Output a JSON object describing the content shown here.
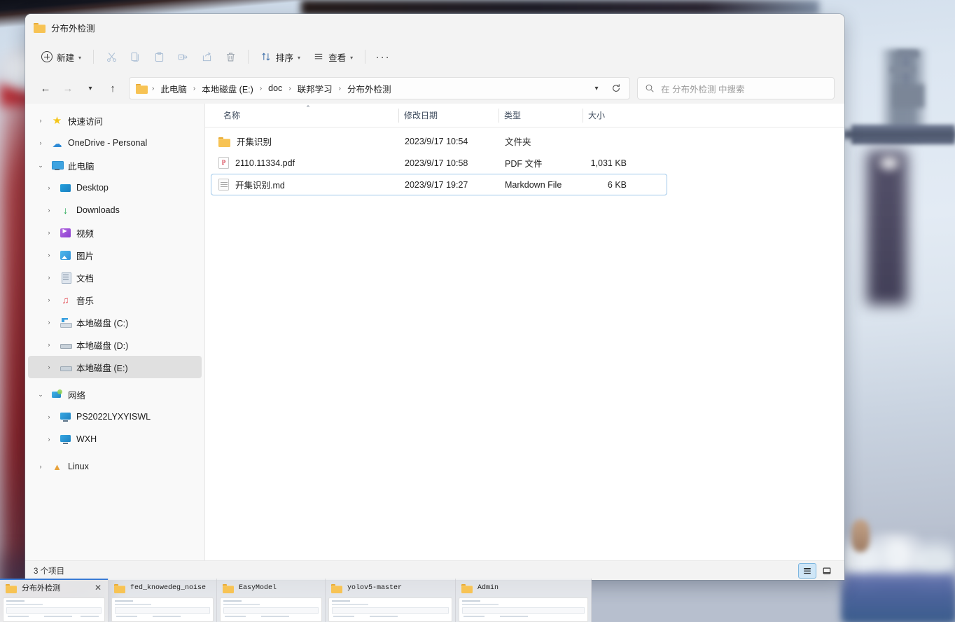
{
  "window": {
    "tab_title": "分布外检测",
    "folder_icon": "folder-icon"
  },
  "toolbar": {
    "new_label": "新建",
    "new_icon": "plus-circle-icon",
    "cut_icon": "scissors-icon",
    "copy_icon": "copy-icon",
    "paste_icon": "paste-icon",
    "rename_icon": "rename-icon",
    "share_icon": "share-icon",
    "delete_icon": "trash-icon",
    "sort_label": "排序",
    "sort_icon": "sort-arrows-icon",
    "view_label": "查看",
    "view_icon": "list-lines-icon",
    "more_label": "···",
    "more_icon": "ellipsis-icon"
  },
  "nav": {
    "back_icon": "arrow-left-icon",
    "forward_icon": "arrow-right-icon",
    "recent_icon": "chevron-down-icon",
    "up_icon": "arrow-up-icon",
    "breadcrumbs": [
      "此电脑",
      "本地磁盘 (E:)",
      "doc",
      "联邦学习",
      "分布外检测"
    ],
    "separator": "›",
    "dropdown_icon": "chevron-down-icon",
    "refresh_icon": "refresh-icon",
    "search_placeholder": "在 分布外检测 中搜索",
    "search_icon": "search-icon",
    "search_value": ""
  },
  "sidebar": {
    "items": [
      {
        "label": "快速访问",
        "level": 0,
        "icon": "star-icon",
        "expander": "›",
        "selected": false
      },
      {
        "label": "OneDrive - Personal",
        "level": 0,
        "icon": "cloud-icon",
        "expander": "›",
        "selected": false
      },
      {
        "label": "此电脑",
        "level": 0,
        "icon": "this-pc-icon",
        "expander": "⌄",
        "selected": false
      },
      {
        "label": "Desktop",
        "level": 1,
        "icon": "desktop-icon",
        "expander": "›",
        "selected": false
      },
      {
        "label": "Downloads",
        "level": 1,
        "icon": "downloads-icon",
        "expander": "›",
        "selected": false
      },
      {
        "label": "视频",
        "level": 1,
        "icon": "videos-icon",
        "expander": "›",
        "selected": false
      },
      {
        "label": "图片",
        "level": 1,
        "icon": "pictures-icon",
        "expander": "›",
        "selected": false
      },
      {
        "label": "文档",
        "level": 1,
        "icon": "documents-icon",
        "expander": "›",
        "selected": false
      },
      {
        "label": "音乐",
        "level": 1,
        "icon": "music-icon",
        "expander": "›",
        "selected": false
      },
      {
        "label": "本地磁盘 (C:)",
        "level": 1,
        "icon": "system-drive-icon",
        "expander": "›",
        "selected": false
      },
      {
        "label": "本地磁盘 (D:)",
        "level": 1,
        "icon": "drive-icon",
        "expander": "›",
        "selected": false
      },
      {
        "label": "本地磁盘 (E:)",
        "level": 1,
        "icon": "drive-icon",
        "expander": "›",
        "selected": true
      },
      {
        "label": "网络",
        "level": 0,
        "icon": "network-icon",
        "expander": "⌄",
        "selected": false
      },
      {
        "label": "PS2022LYXYISWL",
        "level": 1,
        "icon": "computer-icon",
        "expander": "›",
        "selected": false
      },
      {
        "label": "WXH",
        "level": 1,
        "icon": "computer-icon",
        "expander": "›",
        "selected": false
      },
      {
        "label": "Linux",
        "level": 0,
        "icon": "linux-icon",
        "expander": "›",
        "selected": false
      }
    ]
  },
  "filelist": {
    "columns": [
      {
        "key": "name",
        "label": "名称",
        "sorted": true,
        "sort_caret": "⌃"
      },
      {
        "key": "date",
        "label": "修改日期",
        "sorted": false,
        "sort_caret": ""
      },
      {
        "key": "type",
        "label": "类型",
        "sorted": false,
        "sort_caret": ""
      },
      {
        "key": "size",
        "label": "大小",
        "sorted": false,
        "sort_caret": ""
      }
    ],
    "rows": [
      {
        "name": "开集识别",
        "date": "2023/9/17 10:54",
        "type": "文件夹",
        "size": "",
        "icon": "folder-icon",
        "selected": false
      },
      {
        "name": "2110.11334.pdf",
        "date": "2023/9/17 10:58",
        "type": "PDF 文件",
        "size": "1,031 KB",
        "icon": "pdf-file-icon",
        "selected": false
      },
      {
        "name": "开集识别.md",
        "date": "2023/9/17 19:27",
        "type": "Markdown File",
        "size": "6 KB",
        "icon": "md-file-icon",
        "selected": true
      }
    ]
  },
  "statusbar": {
    "item_count": "3 个项目",
    "view_details_icon": "details-view-icon",
    "view_tiles_icon": "tiles-view-icon",
    "active_view": "details"
  },
  "taskbar": {
    "items": [
      {
        "label": "分布外检测",
        "active": true,
        "mono": false,
        "close_icon": "close-icon"
      },
      {
        "label": "fed_knowedeg_noise",
        "active": false,
        "mono": true,
        "close_icon": ""
      },
      {
        "label": "EasyModel",
        "active": false,
        "mono": true,
        "close_icon": ""
      },
      {
        "label": "yolov5-master",
        "active": false,
        "mono": true,
        "close_icon": ""
      },
      {
        "label": "Admin",
        "active": false,
        "mono": true,
        "close_icon": ""
      }
    ]
  },
  "colors": {
    "accent": "#3a7bd5",
    "selection_border": "#9fc8ea",
    "sidebar_selected": "#e0e0e0",
    "folder_yellow": "#f7c354",
    "window_chrome": "#f3f3f3"
  }
}
